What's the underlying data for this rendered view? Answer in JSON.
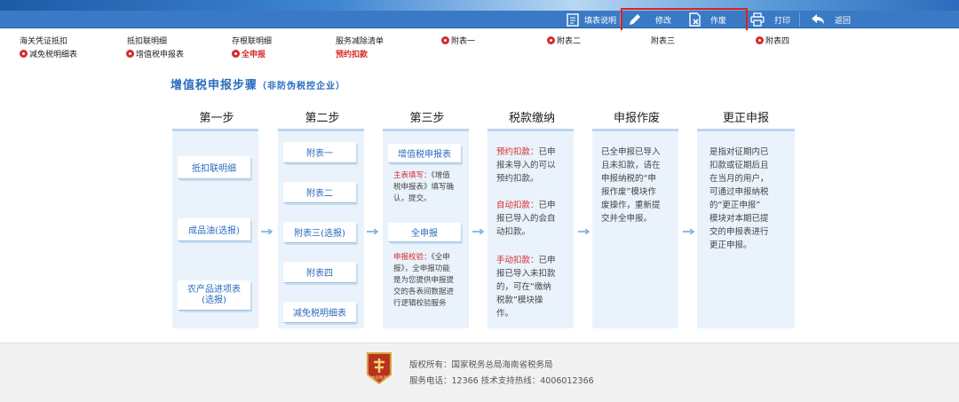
{
  "toolbar": {
    "fill_desc": "填表说明",
    "modify": "修改",
    "void": "作废",
    "print": "打印",
    "back": "返回"
  },
  "nav": {
    "row1": [
      "海关凭证抵扣",
      "抵扣联明细",
      "存根联明细",
      "服务减除清单",
      "附表一",
      "附表二",
      "附表三",
      "附表四"
    ],
    "row2": [
      "减免税明细表",
      "增值税申报表",
      "全申报",
      "预约扣款"
    ]
  },
  "title": {
    "main": "增值税申报步骤",
    "sub": "（非防伪税控企业）"
  },
  "steps": {
    "headers": [
      "第一步",
      "第二步",
      "第三步",
      "税款缴纳",
      "申报作废",
      "更正申报"
    ],
    "step1": [
      "抵扣联明细",
      "成品油(选报)",
      "农产品进项表",
      "(选报)"
    ],
    "step2": [
      "附表一",
      "附表二",
      "附表三(选报)",
      "附表四",
      "减免税明细表"
    ],
    "step3": {
      "btn1": "增值税申报表",
      "note1_label": "主表填写：",
      "note1_lines": [
        "《增值",
        "税申报表》填写确",
        "认，提交。"
      ],
      "btn2": "全申报",
      "note2_label": "申报校验：",
      "note2_lines": [
        "《全申",
        "报》，全申报功能",
        "是为您提供申报提",
        "交的各表间数据进",
        "行逻辑校验服务"
      ]
    },
    "pay": {
      "p1_label": "预约扣款：",
      "p1_lines": [
        "已申",
        "报未导入的可以",
        "预约扣款。"
      ],
      "p2_label": "自动扣款：",
      "p2_lines": [
        "已申",
        "报已导入的会自",
        "动扣款。"
      ],
      "p3_label": "手动扣款：",
      "p3_lines": [
        "已申",
        "报已导入未扣款",
        "的，可在“缴纳",
        "税款”模块操",
        "作。"
      ]
    },
    "void_text": [
      "已全申报已导入",
      "且未扣款，请在",
      "申报纳税的“申",
      "报作废”模块作",
      "废操作，重新提",
      "交并全申报。"
    ],
    "correct_text": [
      "是指对征期内已",
      "扣款或征期后且",
      "在当月的用户，",
      "可通过申报纳税",
      "的“更正申报”",
      "模块对本期已提",
      "交的申报表进行",
      "更正申报。"
    ]
  },
  "footer": {
    "logo_text": "中国税务",
    "copyright": "版权所有：国家税务总局海南省税务局",
    "service": "服务电话：12366 技术支持热线：4006012366"
  },
  "colors": {
    "toolbar": "#3a7ac4",
    "accent_red": "#d42a2a",
    "link_blue": "#2a6bbf",
    "panel": "#eaf3fc"
  }
}
